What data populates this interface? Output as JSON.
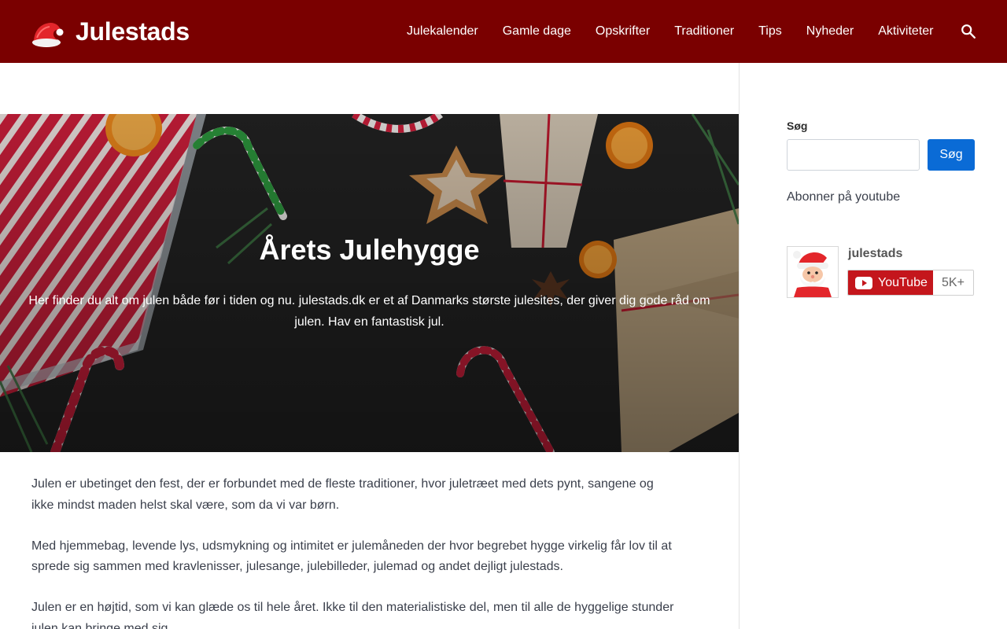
{
  "site": {
    "name": "Julestads"
  },
  "nav": {
    "items": [
      {
        "label": "Julekalender"
      },
      {
        "label": "Gamle dage"
      },
      {
        "label": "Opskrifter"
      },
      {
        "label": "Traditioner"
      },
      {
        "label": "Tips"
      },
      {
        "label": "Nyheder"
      },
      {
        "label": "Aktiviteter"
      }
    ]
  },
  "hero": {
    "title": "Årets Julehygge",
    "text": "Her finder du alt om julen både før i tiden og nu. julestads.dk er et af Danmarks største julesites, der giver dig gode råd om julen. Hav en fantastisk jul."
  },
  "content": {
    "paragraphs": [
      "Julen er ubetinget den fest, der er forbundet med de fleste traditioner, hvor juletræet med dets pynt, sangene og ikke mindst maden helst skal være, som da vi var børn.",
      "Med hjemmebag, levende lys, udsmykning og intimitet er julemåneden der hvor begrebet hygge virkelig får lov til at sprede sig sammen med kravlenisser, julesange, julebilleder, julemad og andet dejligt julestads.",
      "Julen er en højtid, som vi kan glæde os til hele året. Ikke til den materialistiske del, men til alle de hyggelige stunder julen kan bringe med sig."
    ]
  },
  "sidebar": {
    "search_label": "Søg",
    "search_value": "",
    "search_button": "Søg",
    "subscribe_text": "Abonner på youtube",
    "youtube": {
      "channel_name": "julestads",
      "button_label": "YouTube",
      "subscriber_count": "5K+"
    }
  },
  "colors": {
    "header_bg": "#7a0000",
    "primary_button": "#0a6bd6",
    "youtube_red": "#c4161c"
  }
}
